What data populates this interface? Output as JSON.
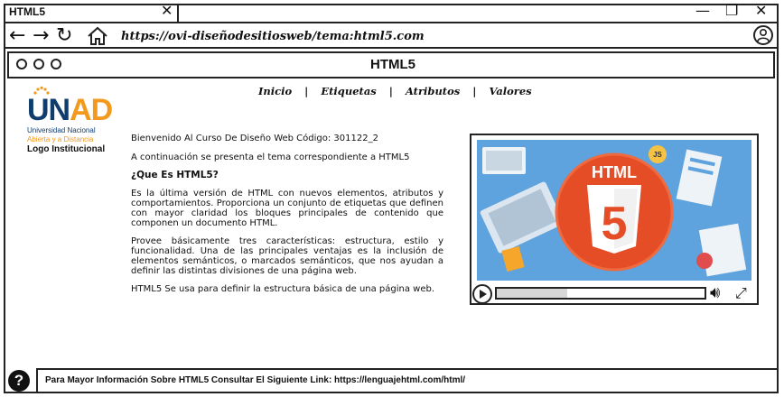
{
  "browser": {
    "tab_title": "HTML5",
    "url": "https://ovi-diseñodesitiosweb/tema:html5.com"
  },
  "page": {
    "title": "HTML5",
    "logo": {
      "brand_un": "UN",
      "brand_ad": "AD",
      "university_line1": "Universidad Nacional",
      "university_line2": "Abierta y a Distancia",
      "caption": "Logo Institucional"
    },
    "menu": {
      "items": [
        "Inicio",
        "Etiquetas",
        "Atributos",
        "Valores"
      ],
      "separator": "|"
    },
    "content": {
      "welcome": "Bienvenido Al Curso De Diseño Web Código: 301122_2",
      "intro": "A continuación se presenta el tema correspondiente a HTML5",
      "question": "¿Que Es HTML5?",
      "paragraph1": "Es la última versión de HTML con nuevos elementos, atributos y comportamientos. Proporciona un conjunto de etiquetas que definen con mayor claridad los bloques principales de contenido que componen un documento HTML.",
      "paragraph2": "Provee básicamente tres características: estructura, estilo y funcionalidad. Una de las principales ventajas es la inclusión de elementos semánticos, o marcados semánticos, que nos ayudan a definir las distintas divisiones de una página web.",
      "paragraph3": "HTML5 Se usa para definir la estructura básica de una página web."
    },
    "video": {
      "badge_text": "HTML",
      "badge_number": "5",
      "progress": 0.34
    },
    "footer": {
      "text": "Para Mayor Información Sobre HTML5 Consultar El Siguiente Link: https://lenguajehtml.com/html/"
    }
  },
  "colors": {
    "unad_blue": "#0f3d6e",
    "unad_orange": "#f39a1e",
    "html5_orange": "#e44d26",
    "video_bg": "#5ea3dd"
  }
}
